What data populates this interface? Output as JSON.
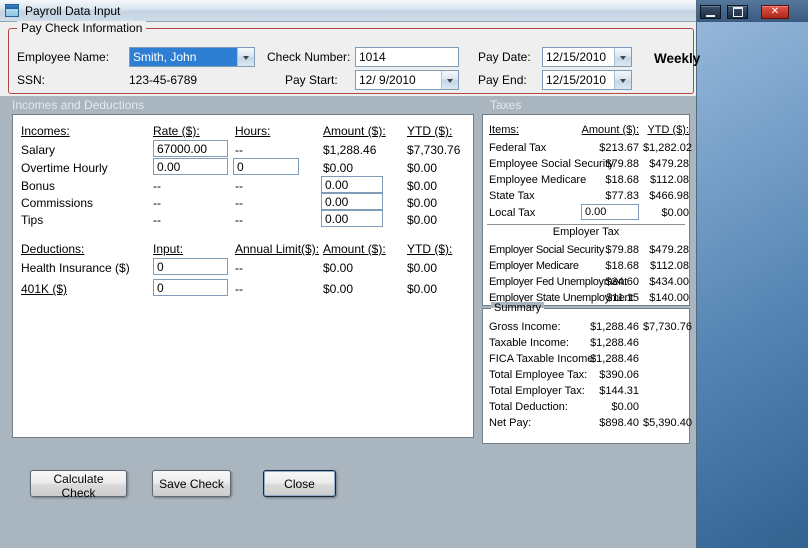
{
  "icons": {
    "close_glyph": "✕"
  },
  "window": {
    "title": "Payroll Data Input"
  },
  "paycheck": {
    "group_title": "Pay Check Information",
    "employee_name_label": "Employee Name:",
    "employee_name_value": "Smith, John",
    "ssn_label": "SSN:",
    "ssn_value": "123-45-6789",
    "check_number_label": "Check Number:",
    "check_number_value": "1014",
    "pay_start_label": "Pay Start:",
    "pay_start_value": "12/ 9/2010",
    "pay_date_label": "Pay Date:",
    "pay_date_value": "12/15/2010",
    "pay_end_label": "Pay End:",
    "pay_end_value": "12/15/2010",
    "frequency": "Weekly"
  },
  "sections": {
    "incomes_deductions": "Incomes and Deductions",
    "taxes": "Taxes"
  },
  "incomes": {
    "headers": {
      "name": "Incomes:",
      "rate": "Rate ($):",
      "hours": "Hours:",
      "amount": "Amount ($):",
      "ytd": "YTD ($):"
    },
    "salary": {
      "name": "Salary",
      "rate": "67000.00",
      "hours": "--",
      "amount": "$1,288.46",
      "ytd": "$7,730.76"
    },
    "overtime": {
      "name": "Overtime Hourly",
      "rate": "0.00",
      "hours": "0",
      "amount": "$0.00",
      "ytd": "$0.00"
    },
    "bonus": {
      "name": "Bonus",
      "rate": "--",
      "hours": "--",
      "amount": "0.00",
      "ytd": "$0.00"
    },
    "commissions": {
      "name": "Commissions",
      "rate": "--",
      "hours": "--",
      "amount": "0.00",
      "ytd": "$0.00"
    },
    "tips": {
      "name": "Tips",
      "rate": "--",
      "hours": "--",
      "amount": "0.00",
      "ytd": "$0.00"
    }
  },
  "deductions": {
    "headers": {
      "name": "Deductions:",
      "input": "Input:",
      "limit": "Annual Limit($):",
      "amount": "Amount ($):",
      "ytd": "YTD ($):"
    },
    "health": {
      "name": "Health Insurance ($)",
      "input": "0",
      "limit": "--",
      "amount": "$0.00",
      "ytd": "$0.00"
    },
    "k401": {
      "name": "401K ($)",
      "input": "0",
      "limit": "--",
      "amount": "$0.00",
      "ytd": "$0.00"
    }
  },
  "taxes": {
    "headers": {
      "items": "Items:",
      "amount": "Amount ($):",
      "ytd": "YTD ($):"
    },
    "rows": [
      {
        "name": "Federal Tax",
        "amount": "$213.67",
        "ytd": "$1,282.02"
      },
      {
        "name": "Employee Social Security",
        "amount": "$79.88",
        "ytd": "$479.28"
      },
      {
        "name": "Employee Medicare",
        "amount": "$18.68",
        "ytd": "$112.08"
      },
      {
        "name": "State Tax",
        "amount": "$77.83",
        "ytd": "$466.98"
      }
    ],
    "local_tax": {
      "name": "Local Tax",
      "amount": "0.00",
      "ytd": "$0.00"
    },
    "employer_header": "Employer Tax",
    "employer_rows": [
      {
        "name": "Employer Social Security",
        "amount": "$79.88",
        "ytd": "$479.28"
      },
      {
        "name": "Employer Medicare",
        "amount": "$18.68",
        "ytd": "$112.08"
      },
      {
        "name": "Employer Fed Unemployment",
        "amount": "$34.60",
        "ytd": "$434.00"
      },
      {
        "name": "Employer State Unemployment",
        "amount": "$11.15",
        "ytd": "$140.00"
      }
    ]
  },
  "summary": {
    "title": "Summary",
    "rows": [
      {
        "name": "Gross Income:",
        "amount": "$1,288.46",
        "ytd": "$7,730.76"
      },
      {
        "name": "Taxable Income:",
        "amount": "$1,288.46",
        "ytd": ""
      },
      {
        "name": "FICA Taxable Income:",
        "amount": "$1,288.46",
        "ytd": ""
      },
      {
        "name": "Total Employee Tax:",
        "amount": "$390.06",
        "ytd": ""
      },
      {
        "name": "Total Employer Tax:",
        "amount": "$144.31",
        "ytd": ""
      },
      {
        "name": "Total Deduction:",
        "amount": "$0.00",
        "ytd": ""
      },
      {
        "name": "Net Pay:",
        "amount": "$898.40",
        "ytd": "$5,390.40"
      }
    ]
  },
  "buttons": {
    "calculate": "Calculate Check",
    "save": "Save Check",
    "close": "Close"
  }
}
